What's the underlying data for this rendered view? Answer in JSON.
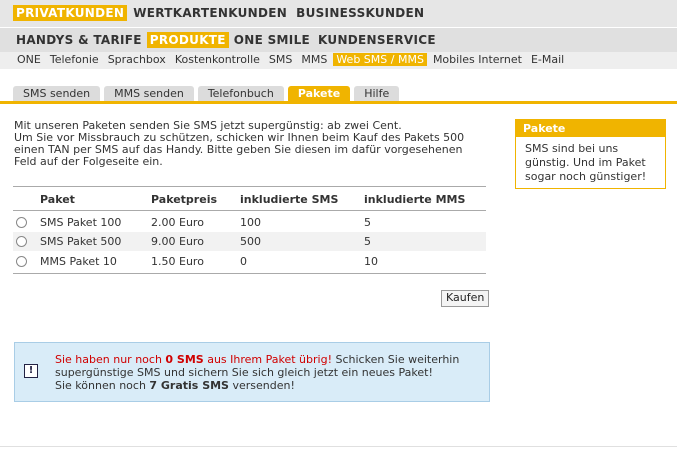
{
  "nav1": [
    "PRIVATKUNDEN",
    "WERTKARTENKUNDEN",
    "BUSINESSKUNDEN"
  ],
  "nav2": [
    "HANDYS & TARIFE",
    "PRODUKTE",
    "ONE SMILE",
    "KUNDENSERVICE"
  ],
  "nav3": [
    "ONE",
    "Telefonie",
    "Sprachbox",
    "Kostenkontrolle",
    "SMS",
    "MMS",
    "Web SMS / MMS",
    "Mobiles Internet",
    "E-Mail"
  ],
  "tabs": [
    "SMS senden",
    "MMS senden",
    "Telefonbuch",
    "Pakete",
    "Hilfe"
  ],
  "intro": {
    "line1": "Mit unseren Paketen senden Sie SMS jetzt supergünstig: ab zwei Cent.",
    "line2": "Um Sie vor Missbrauch zu schützen, schicken wir Ihnen beim Kauf des Pakets 500",
    "line3": "einen TAN per SMS auf das Handy. Bitte geben Sie diesen im dafür vorgesehenen",
    "line4": "Feld auf der Folgeseite ein."
  },
  "table": {
    "headers": [
      "Paket",
      "Paketpreis",
      "inkludierte SMS",
      "inkludierte MMS"
    ],
    "rows": [
      [
        "SMS Paket 100",
        "2.00 Euro",
        "100",
        "5"
      ],
      [
        "SMS Paket 500",
        "9.00 Euro",
        "500",
        "5"
      ],
      [
        "MMS Paket 10",
        "1.50 Euro",
        "0",
        "10"
      ]
    ]
  },
  "buy_button": "Kaufen",
  "notice": {
    "icon": "!",
    "p1": "Sie haben nur noch ",
    "p2": "0 SMS",
    "p3": " aus Ihrem Paket übrig!",
    "p4": " Schicken Sie weiterhin",
    "p5": "supergünstige SMS und sichern Sie sich gleich jetzt ein ",
    "p6": "neues Paket",
    "p7": "!",
    "p8": "Sie können noch ",
    "p9": "7 Gratis SMS",
    "p10": " versenden!"
  },
  "sidebox": {
    "title": "Pakete",
    "line1": "SMS sind bei uns",
    "line2": "günstig. Und im Paket",
    "line3": "sogar noch günstiger!"
  },
  "colors": {
    "accent": "#f0b400",
    "alert": "#d00000",
    "notice_bg": "#d9ecf8"
  }
}
